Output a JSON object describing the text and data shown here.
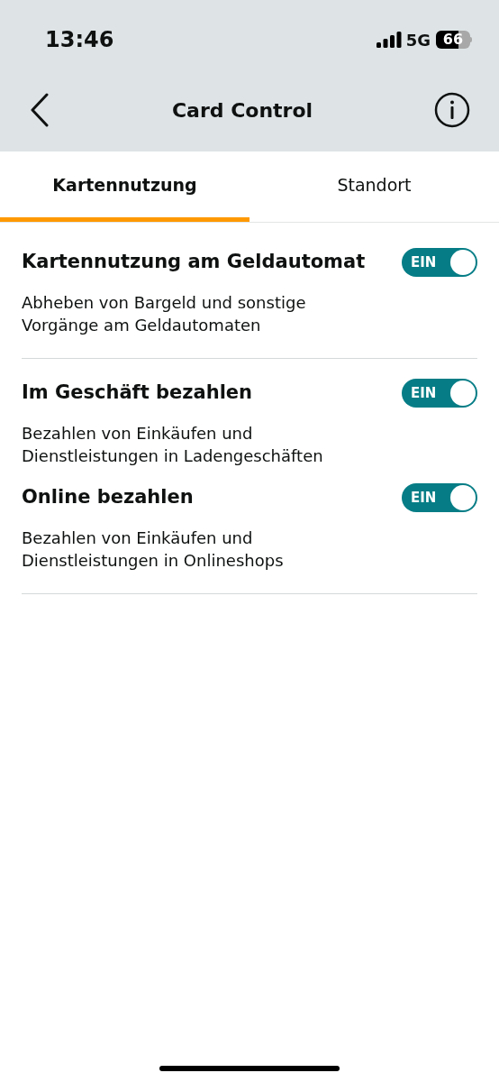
{
  "status_bar": {
    "time": "13:46",
    "network": "5G",
    "battery": "66"
  },
  "header": {
    "title": "Card Control"
  },
  "tabs": [
    {
      "label": "Kartennutzung",
      "selected": true
    },
    {
      "label": "Standort",
      "selected": false
    }
  ],
  "groups": [
    {
      "settings": [
        {
          "title": "Kartennutzung am Geldautomat",
          "description": "Abheben von Bargeld und sonstige\nVorgänge am Geldautomaten",
          "on": true,
          "toggle_label": "EIN"
        }
      ]
    },
    {
      "settings": [
        {
          "title": "Im Geschäft bezahlen",
          "description": "Bezahlen von Einkäufen und\nDienstleistungen in Ladengeschäften",
          "on": true,
          "toggle_label": "EIN"
        },
        {
          "title": "Online bezahlen",
          "description": "Bezahlen von Einkäufen und\nDienstleistungen in Onlineshops",
          "on": true,
          "toggle_label": "EIN"
        }
      ]
    }
  ]
}
